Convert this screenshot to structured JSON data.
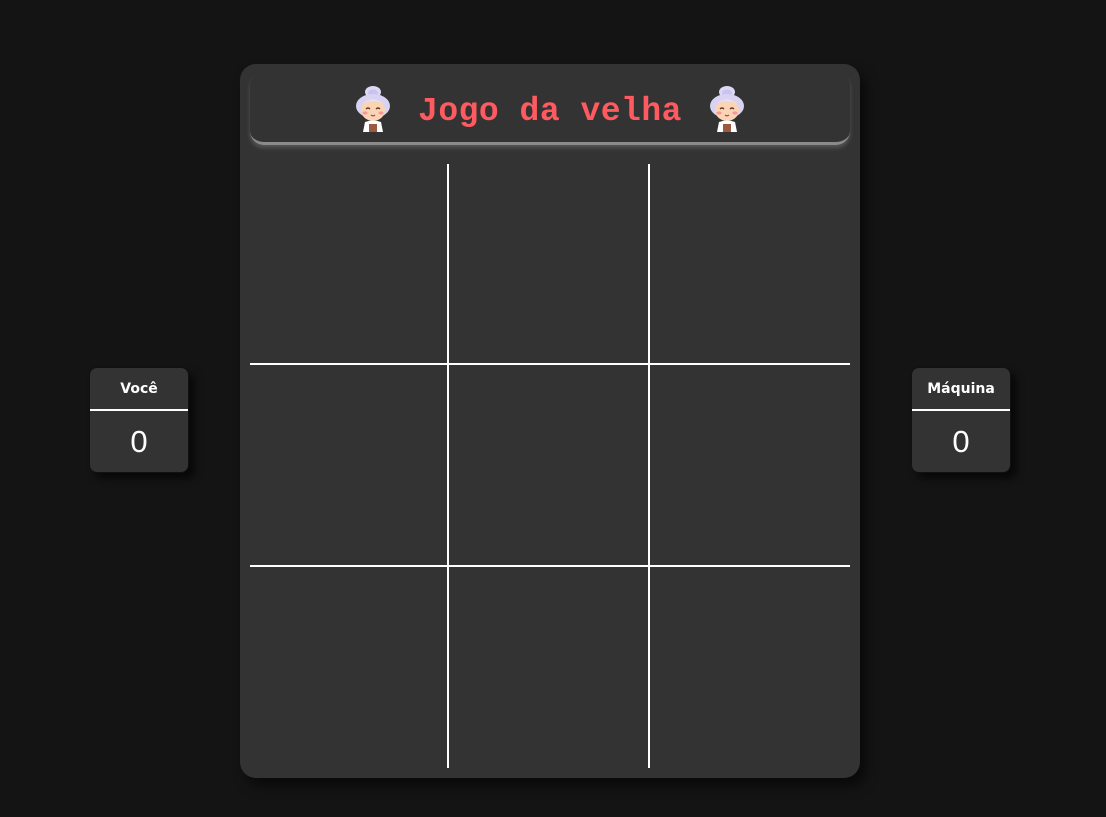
{
  "title": "Jogo da velha",
  "colors": {
    "background": "#141414",
    "panel": "#333333",
    "title": "#ff5a5f",
    "lines": "#ffffff"
  },
  "header": {
    "left_icon": "grandma-icon",
    "right_icon": "grandma-icon"
  },
  "board": {
    "cells": [
      "",
      "",
      "",
      "",
      "",
      "",
      "",
      "",
      ""
    ]
  },
  "scores": {
    "player": {
      "label": "Você",
      "value": "0"
    },
    "machine": {
      "label": "Máquina",
      "value": "0"
    }
  }
}
